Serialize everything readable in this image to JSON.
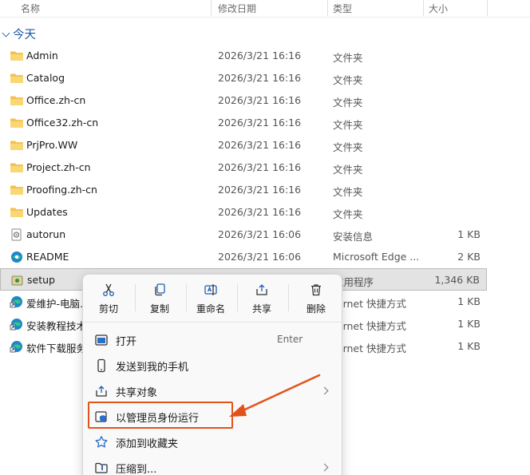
{
  "columns": {
    "name": "名称",
    "date": "修改日期",
    "type": "类型",
    "size": "大小"
  },
  "group": {
    "label": "今天"
  },
  "files": [
    {
      "icon": "folder-icon",
      "name": "Admin",
      "date": "2026/3/21 16:16",
      "type": "文件夹",
      "size": ""
    },
    {
      "icon": "folder-icon",
      "name": "Catalog",
      "date": "2026/3/21 16:16",
      "type": "文件夹",
      "size": ""
    },
    {
      "icon": "folder-icon",
      "name": "Office.zh-cn",
      "date": "2026/3/21 16:16",
      "type": "文件夹",
      "size": ""
    },
    {
      "icon": "folder-icon",
      "name": "Office32.zh-cn",
      "date": "2026/3/21 16:16",
      "type": "文件夹",
      "size": ""
    },
    {
      "icon": "folder-icon",
      "name": "PrjPro.WW",
      "date": "2026/3/21 16:16",
      "type": "文件夹",
      "size": ""
    },
    {
      "icon": "folder-icon",
      "name": "Project.zh-cn",
      "date": "2026/3/21 16:16",
      "type": "文件夹",
      "size": ""
    },
    {
      "icon": "folder-icon",
      "name": "Proofing.zh-cn",
      "date": "2026/3/21 16:16",
      "type": "文件夹",
      "size": ""
    },
    {
      "icon": "folder-icon",
      "name": "Updates",
      "date": "2026/3/21 16:16",
      "type": "文件夹",
      "size": ""
    },
    {
      "icon": "setup-info-icon",
      "name": "autorun",
      "date": "2026/3/21 16:06",
      "type": "安装信息",
      "size": "1 KB"
    },
    {
      "icon": "edge-icon",
      "name": "README",
      "date": "2026/3/21 16:06",
      "type": "Microsoft Edge ...",
      "size": "2 KB"
    },
    {
      "icon": "setup-exe-icon",
      "name": "setup",
      "date": "",
      "type": "应用程序",
      "size": "1,346 KB"
    },
    {
      "icon": "edge-link-icon",
      "name": "爱维护-电脑…",
      "date": "",
      "type": "ternet 快捷方式",
      "size": "1 KB"
    },
    {
      "icon": "edge-link-icon",
      "name": "安装教程技术…",
      "date": "",
      "type": "ternet 快捷方式",
      "size": "1 KB"
    },
    {
      "icon": "edge-link-icon",
      "name": "软件下载服务…",
      "date": "",
      "type": "ternet 快捷方式",
      "size": "1 KB"
    }
  ],
  "context_menu": {
    "toolbar": [
      {
        "icon": "scissors-icon",
        "label": "剪切"
      },
      {
        "icon": "copy-icon",
        "label": "复制"
      },
      {
        "icon": "rename-icon",
        "label": "重命名"
      },
      {
        "icon": "share-icon",
        "label": "共享"
      },
      {
        "icon": "trash-icon",
        "label": "删除"
      }
    ],
    "items": [
      {
        "icon": "open-icon",
        "label": "打开",
        "shortcut": "Enter",
        "submenu": false
      },
      {
        "icon": "phone-icon",
        "label": "发送到我的手机",
        "shortcut": "",
        "submenu": false
      },
      {
        "icon": "share-icon",
        "label": "共享对象",
        "shortcut": "",
        "submenu": true
      },
      {
        "icon": "shield-icon",
        "label": "以管理员身份运行",
        "shortcut": "",
        "submenu": false
      },
      {
        "icon": "star-icon",
        "label": "添加到收藏夹",
        "shortcut": "",
        "submenu": false
      },
      {
        "icon": "zip-icon",
        "label": "压缩到...",
        "shortcut": "",
        "submenu": true
      }
    ]
  },
  "colors": {
    "annotation": "#e2531c",
    "accent": "#1d5aa8",
    "folder": "#f2c14e"
  }
}
